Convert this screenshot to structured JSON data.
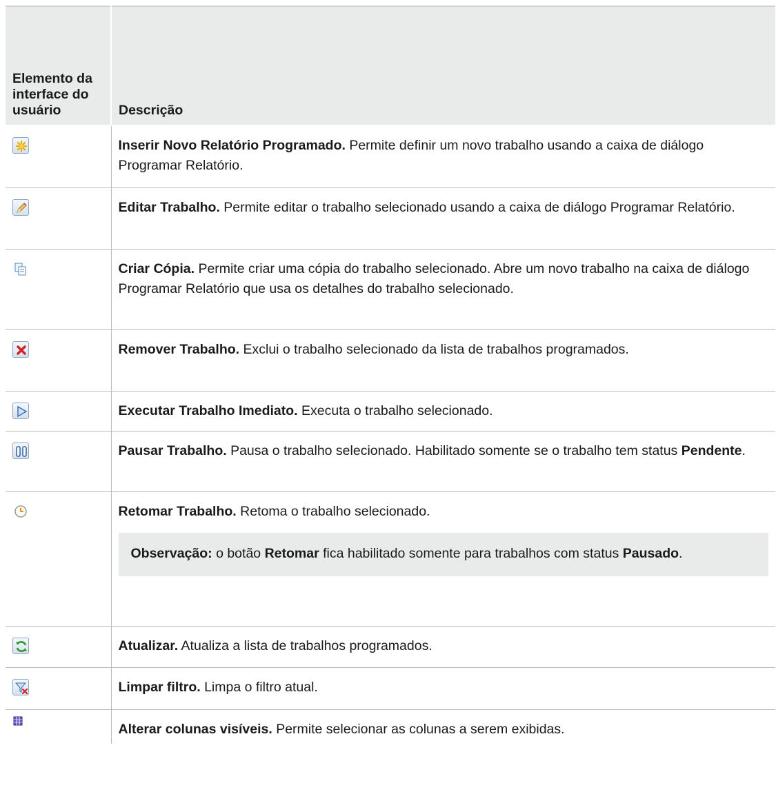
{
  "header": {
    "col1": "Elemento da interface do usuário",
    "col2": "Descrição"
  },
  "rows": [
    {
      "icon": "new-scheduled-report-icon",
      "title": "Inserir Novo Relatório Programado.",
      "text": " Permite definir um novo trabalho usando a caixa de diálogo Programar Relatório."
    },
    {
      "icon": "edit-pencil-icon",
      "title": "Editar Trabalho.",
      "text": " Permite editar o trabalho selecionado usando a caixa de diálogo Programar Relatório."
    },
    {
      "icon": "copy-icon",
      "title": "Criar Cópia.",
      "text": " Permite criar uma cópia do trabalho selecionado. Abre um novo trabalho na caixa de diálogo Programar Relatório que usa os detalhes do trabalho selecionado."
    },
    {
      "icon": "delete-x-icon",
      "title": "Remover Trabalho.",
      "text": " Exclui o trabalho selecionado da lista de trabalhos programados."
    },
    {
      "icon": "run-play-icon",
      "title": "Executar Trabalho Imediato.",
      "text": " Executa o trabalho selecionado."
    },
    {
      "icon": "pause-icon",
      "title": "Pausar Trabalho.",
      "text": " Pausa o trabalho selecionado. Habilitado somente se o trabalho tem status ",
      "bold_tail": "Pendente",
      "tail": "."
    },
    {
      "icon": "resume-clock-icon",
      "title": "Retomar Trabalho.",
      "text": " Retoma o trabalho selecionado.",
      "note": {
        "label": "Observação:",
        "t1": " o botão ",
        "b1": "Retomar",
        "t2": " fica habilitado somente para trabalhos com status ",
        "b2": "Pausado",
        "t3": "."
      }
    },
    {
      "icon": "refresh-icon",
      "title": "Atualizar.",
      "text": " Atualiza a lista de trabalhos programados."
    },
    {
      "icon": "clear-filter-icon",
      "title": "Limpar filtro.",
      "text": " Limpa o filtro atual."
    },
    {
      "icon": "columns-icon",
      "title": "Alterar colunas visíveis.",
      "text": " Permite selecionar as colunas a serem exibidas."
    }
  ]
}
